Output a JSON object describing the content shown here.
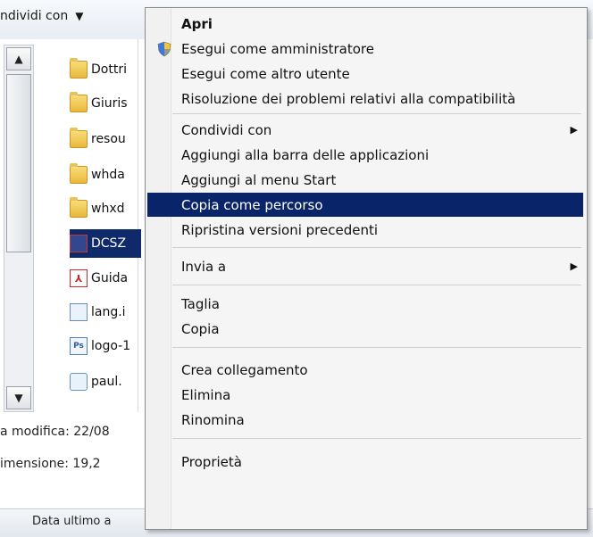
{
  "toolbar": {
    "share_label": "ndividi con",
    "caret": "▼"
  },
  "scrollbar": {
    "up": "▲",
    "down": "▼"
  },
  "files": [
    {
      "name": "Dottri",
      "type": "folder"
    },
    {
      "name": "Giuris",
      "type": "folder"
    },
    {
      "name": "resou",
      "type": "folder"
    },
    {
      "name": "whda",
      "type": "folder"
    },
    {
      "name": "whxd",
      "type": "folder"
    },
    {
      "name": "DCSZ",
      "type": "dcs",
      "selected": true
    },
    {
      "name": "Guida",
      "type": "pdf"
    },
    {
      "name": "lang.i",
      "type": "ini"
    },
    {
      "name": "logo-1",
      "type": "ps"
    },
    {
      "name": "paul.",
      "type": "paul"
    }
  ],
  "details": {
    "modified": "a modifica: 22/08",
    "size": "imensione: 19,2"
  },
  "statusbar": {
    "text": "Data ultimo a"
  },
  "menu": {
    "items": [
      {
        "label": "Apri",
        "bold": true
      },
      {
        "label": "Esegui come amministratore",
        "icon": "uac-shield-icon"
      },
      {
        "label": "Esegui come altro utente"
      },
      {
        "label": "Risoluzione dei problemi relativi alla compatibilità"
      },
      {
        "label": "Condividi con",
        "submenu": true
      },
      {
        "label": "Aggiungi alla barra delle applicazioni"
      },
      {
        "label": "Aggiungi al menu Start"
      },
      {
        "label": "Copia come percorso",
        "highlighted": true
      },
      {
        "label": "Ripristina versioni precedenti"
      },
      {
        "label": "Invia a",
        "submenu": true
      },
      {
        "label": "Taglia"
      },
      {
        "label": "Copia"
      },
      {
        "label": "Crea collegamento"
      },
      {
        "label": "Elimina"
      },
      {
        "label": "Rinomina"
      },
      {
        "label": "Proprietà"
      }
    ],
    "submenu_arrow": "▶",
    "highlight_color": "#0a246a"
  }
}
